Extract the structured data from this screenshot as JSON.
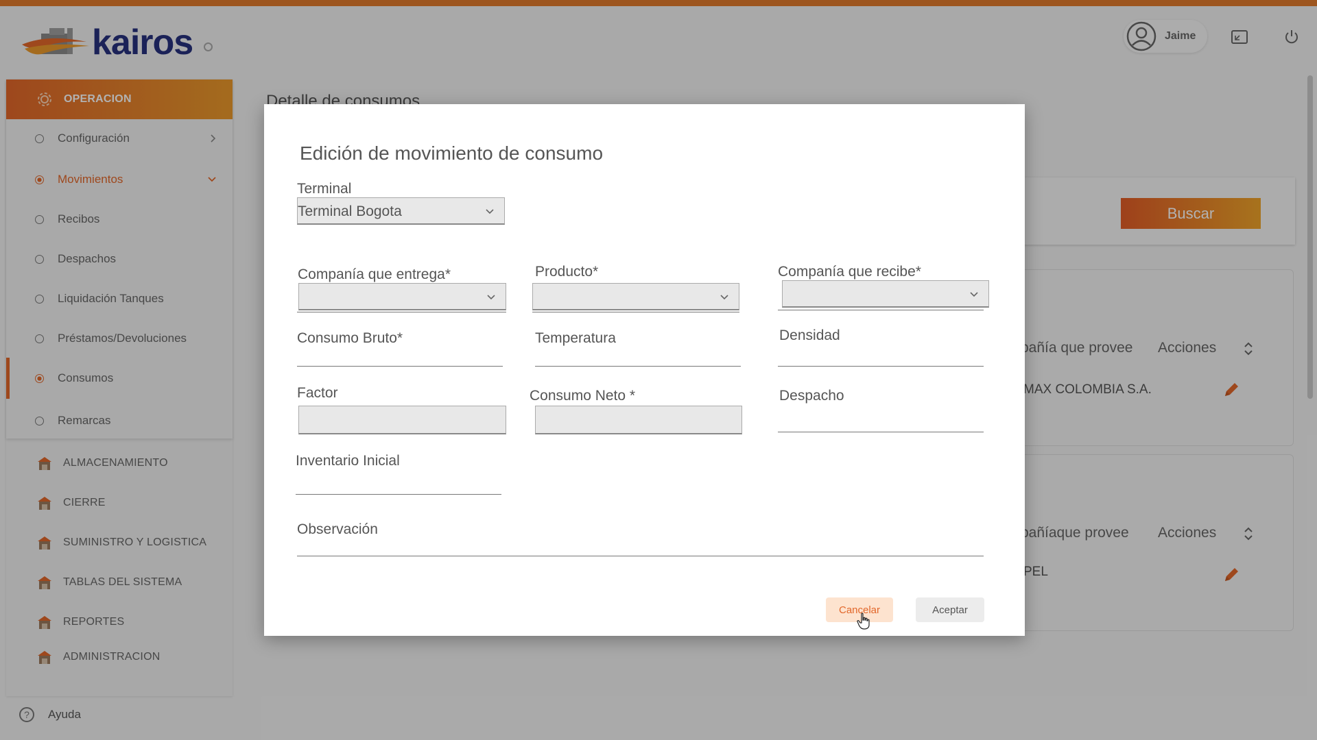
{
  "app": {
    "logo_text": "kairos",
    "user_name": "Jaime"
  },
  "sidebar": {
    "section_title": "OPERACION",
    "items": [
      {
        "label": "Configuración",
        "state": "collapsed"
      },
      {
        "label": "Movimientos",
        "state": "expanded"
      },
      {
        "label": "Recibos"
      },
      {
        "label": "Despachos"
      },
      {
        "label": "Liquidación Tanques"
      },
      {
        "label": "Préstamos/Devoluciones"
      },
      {
        "label": "Consumos",
        "active": true
      },
      {
        "label": "Remarcas"
      }
    ],
    "sections": [
      "ALMACENAMIENTO",
      "CIERRE",
      "SUMINISTRO Y LOGISTICA",
      "TABLAS DEL SISTEMA",
      "REPORTES",
      "ADMINISTRACION"
    ],
    "help_label": "Ayuda"
  },
  "page": {
    "title": "Detalle de consumos",
    "search_button": "Buscar",
    "card1": {
      "col_provider": "pañía que provee",
      "col_actions": "Acciones",
      "value": "MAX COLOMBIA S.A."
    },
    "card2": {
      "col_provider": "pañíaque provee",
      "col_actions": "Acciones",
      "value": "PEL"
    }
  },
  "modal": {
    "title": "Edición de movimiento de consumo",
    "terminal_label": "Terminal",
    "terminal_value": "Terminal Bogota",
    "company_delivers_label": "Companía que entrega*",
    "product_label": "Producto*",
    "company_receives_label": "Companía que recibe*",
    "gross_label": "Consumo Bruto*",
    "temperature_label": "Temperatura",
    "density_label": "Densidad",
    "factor_label": "Factor",
    "net_label": "Consumo Neto *",
    "dispatch_label": "Despacho",
    "initial_inventory_label": "Inventario Inicial",
    "observation_label": "Observación",
    "cancel_label": "Cancelar",
    "accept_label": "Aceptar"
  },
  "colors": {
    "accent": "#e2672a",
    "accent_light": "#eb9a2b",
    "brand_blue": "#27327f"
  }
}
